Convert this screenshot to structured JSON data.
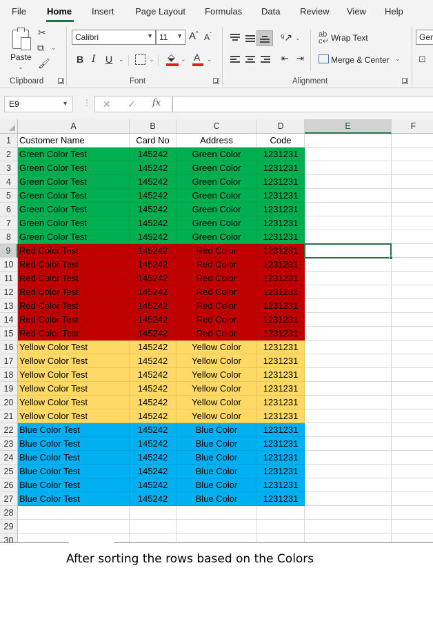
{
  "menu": {
    "tabs": [
      {
        "label": "File"
      },
      {
        "label": "Home"
      },
      {
        "label": "Insert"
      },
      {
        "label": "Page Layout"
      },
      {
        "label": "Formulas"
      },
      {
        "label": "Data"
      },
      {
        "label": "Review"
      },
      {
        "label": "View"
      },
      {
        "label": "Help"
      }
    ],
    "active": "Home"
  },
  "ribbon": {
    "clipboard": {
      "paste_label": "Paste",
      "group_label": "Clipboard"
    },
    "font": {
      "font_name": "Calibri",
      "font_size": "11",
      "bold": "B",
      "italic": "I",
      "underline": "U",
      "grow": "A",
      "shrink": "A",
      "group_label": "Font"
    },
    "alignment": {
      "wrap_text": "Wrap Text",
      "merge_center": "Merge & Center",
      "group_label": "Alignment"
    },
    "number": {
      "format_partial": "Gen"
    }
  },
  "formula_bar": {
    "name_box": "E9",
    "fx": "fx",
    "formula": ""
  },
  "sheet": {
    "columns": [
      {
        "letter": "A"
      },
      {
        "letter": "B"
      },
      {
        "letter": "C"
      },
      {
        "letter": "D"
      },
      {
        "letter": "E"
      },
      {
        "letter": "F"
      }
    ],
    "selected_column": "E",
    "selected_row": "9",
    "header_row": [
      "Customer Name",
      "Card No",
      "Address",
      "Code"
    ],
    "rows": [
      [
        "Green Color Test",
        "145242",
        "Green Color",
        "1231231"
      ],
      [
        "Green Color Test",
        "145242",
        "Green Color",
        "1231231"
      ],
      [
        "Green Color Test",
        "145242",
        "Green Color",
        "1231231"
      ],
      [
        "Green Color Test",
        "145242",
        "Green Color",
        "1231231"
      ],
      [
        "Green Color Test",
        "145242",
        "Green Color",
        "1231231"
      ],
      [
        "Green Color Test",
        "145242",
        "Green Color",
        "1231231"
      ],
      [
        "Green Color Test",
        "145242",
        "Green Color",
        "1231231"
      ],
      [
        "Red Color Test",
        "145242",
        "Red Color",
        "1231231"
      ],
      [
        "Red Color Test",
        "145242",
        "Red Color",
        "1231231"
      ],
      [
        "Red Color Test",
        "145242",
        "Red Color",
        "1231231"
      ],
      [
        "Red Color Test",
        "145242",
        "Red Color",
        "1231231"
      ],
      [
        "Red Color Test",
        "145242",
        "Red Color",
        "1231231"
      ],
      [
        "Red Color Test",
        "145242",
        "Red Color",
        "1231231"
      ],
      [
        "Red Color Test",
        "145242",
        "Red Color",
        "1231231"
      ],
      [
        "Yellow Color Test",
        "145242",
        "Yellow Color",
        "1231231"
      ],
      [
        "Yellow Color Test",
        "145242",
        "Yellow Color",
        "1231231"
      ],
      [
        "Yellow Color Test",
        "145242",
        "Yellow Color",
        "1231231"
      ],
      [
        "Yellow Color Test",
        "145242",
        "Yellow Color",
        "1231231"
      ],
      [
        "Yellow Color Test",
        "145242",
        "Yellow Color",
        "1231231"
      ],
      [
        "Yellow Color Test",
        "145242",
        "Yellow Color",
        "1231231"
      ],
      [
        "Blue Color Test",
        "145242",
        "Blue Color",
        "1231231"
      ],
      [
        "Blue Color Test",
        "145242",
        "Blue Color",
        "1231231"
      ],
      [
        "Blue Color Test",
        "145242",
        "Blue Color",
        "1231231"
      ],
      [
        "Blue Color Test",
        "145242",
        "Blue Color",
        "1231231"
      ],
      [
        "Blue Color Test",
        "145242",
        "Blue Color",
        "1231231"
      ],
      [
        "Blue Color Test",
        "145242",
        "Blue Color",
        "1231231"
      ],
      [
        "",
        "",
        "",
        ""
      ],
      [
        "",
        "",
        "",
        ""
      ],
      [
        "",
        "",
        "",
        ""
      ]
    ],
    "row_fill": [
      "#ffffff",
      "#00b050",
      "#00b050",
      "#00b050",
      "#00b050",
      "#00b050",
      "#00b050",
      "#00b050",
      "#c00000",
      "#c00000",
      "#c00000",
      "#c00000",
      "#c00000",
      "#c00000",
      "#c00000",
      "#ffd966",
      "#ffd966",
      "#ffd966",
      "#ffd966",
      "#ffd966",
      "#ffd966",
      "#00b0f0",
      "#00b0f0",
      "#00b0f0",
      "#00b0f0",
      "#00b0f0",
      "#00b0f0",
      "#ffffff",
      "#ffffff",
      "#ffffff"
    ]
  },
  "colors": {
    "excel_green": "#217346",
    "font_red": "#e02020"
  },
  "caption": "After sorting the rows based on the Colors"
}
